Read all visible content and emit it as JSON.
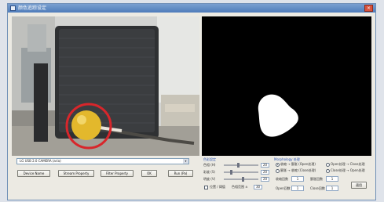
{
  "window": {
    "title": "颜色追踪设定",
    "close_glyph": "×"
  },
  "camera": {
    "device_selected": "LG USB 2.0 CAMERA (aria)",
    "dropdown_glyph": "▾"
  },
  "buttons": {
    "device_name": "Device Name",
    "stream_property": "Stream Property",
    "filter_property": "Filter Property",
    "ok": "OK",
    "run_pause": "Run (Pa)"
  },
  "color_settings": {
    "title": "色彩設定",
    "sliders": [
      {
        "label": "色相 (H)",
        "value": "20",
        "level": 0.42
      },
      {
        "label": "彩度 (S)",
        "value": "20",
        "level": 0.2
      },
      {
        "label": "明度 (V)",
        "value": "20",
        "level": 0.55
      }
    ],
    "checkbox_label": "位置 / 阈值",
    "color_range_label": "色相范围 ±",
    "color_range_value": "30"
  },
  "morphology": {
    "title": "Morphology 处理",
    "options": [
      {
        "label": "收缩 → 膨胀 (Open处理)",
        "selected": true
      },
      {
        "label": "Open处理 → Close处理",
        "selected": false
      },
      {
        "label": "膨胀 → 收缩 (Close处理)",
        "selected": false
      },
      {
        "label": "Close处理 → Open处理",
        "selected": false
      }
    ],
    "fields": [
      {
        "label": "收缩回数",
        "value": "1"
      },
      {
        "label": "膨胀回数",
        "value": "1"
      },
      {
        "label": "Open回数",
        "value": "1"
      },
      {
        "label": "Close回数",
        "value": "1"
      }
    ],
    "apply_label": "適用"
  },
  "colors": {
    "titlebar": "#4f7cba",
    "highlight_circle": "#d8262b",
    "ball": "#e3b82c"
  }
}
